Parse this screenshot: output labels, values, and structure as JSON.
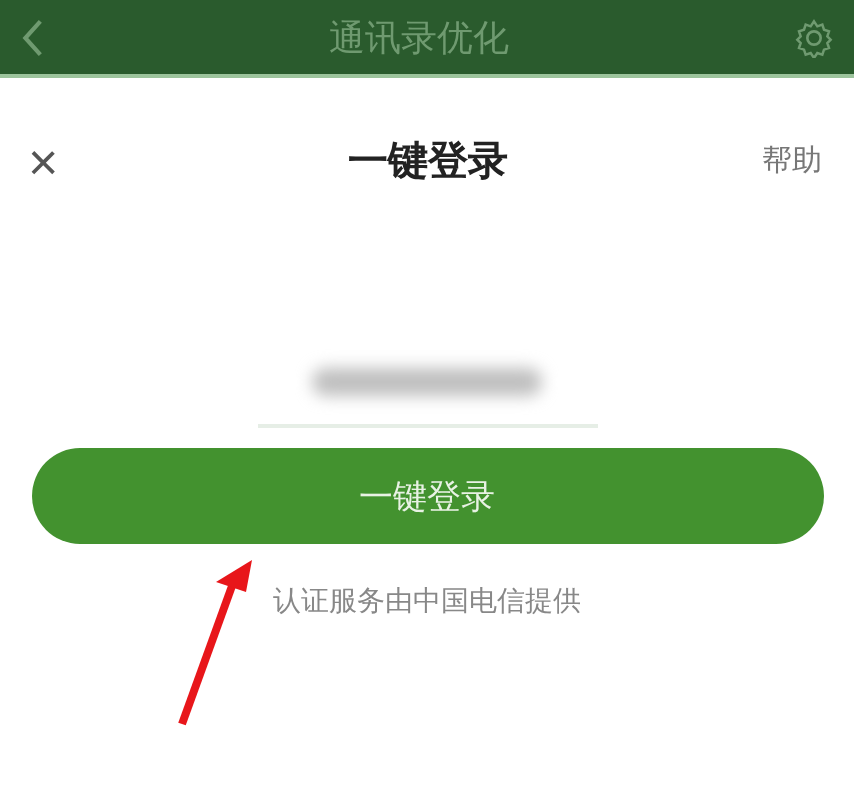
{
  "app_bar": {
    "title": "通讯录优化"
  },
  "dialog": {
    "close": "×",
    "title": "一键登录",
    "help": "帮助"
  },
  "login_button": {
    "label": "一键登录"
  },
  "provider_note": "认证服务由中国电信提供"
}
